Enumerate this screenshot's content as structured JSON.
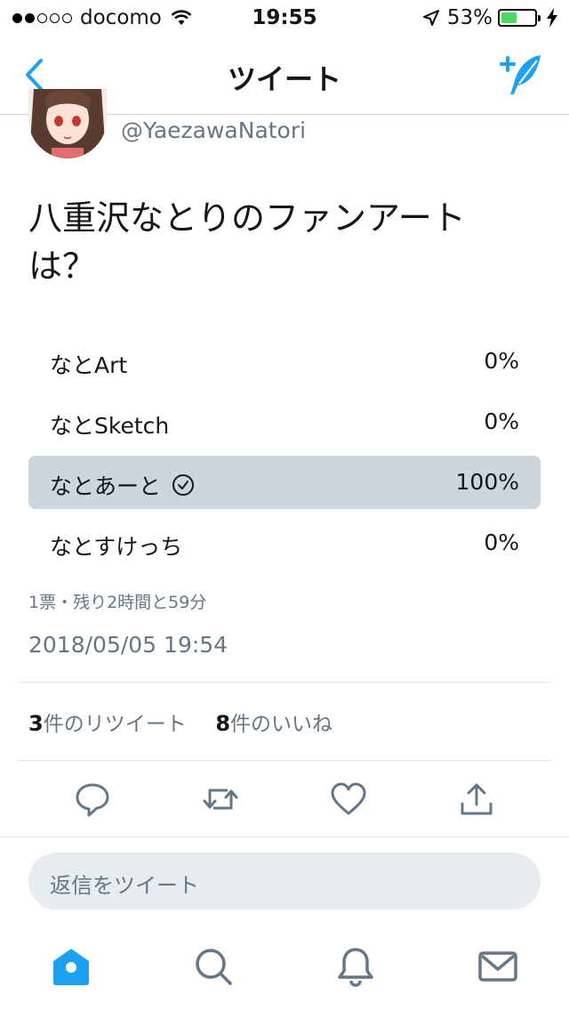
{
  "status_bar": {
    "carrier": "docomo",
    "time": "19:55",
    "battery_percent": "53%",
    "battery_level": 0.53,
    "signal_bars_filled": 2,
    "signal_bars_total": 5
  },
  "nav": {
    "title": "ツイート",
    "back_icon": "chevron-left-icon",
    "compose_icon": "compose-feather-icon"
  },
  "tweet": {
    "handle": "@YaezawaNatori",
    "text_line1": "八重沢なとりのファンアート",
    "text_line2": "は？"
  },
  "poll": {
    "options": [
      {
        "label": "なとArt",
        "percent": "0%"
      },
      {
        "label": "なとSketch",
        "percent": "0%"
      },
      {
        "label": "なとあーと",
        "percent": "100%",
        "selected": true
      },
      {
        "label": "なとすけっち",
        "percent": "0%"
      }
    ],
    "meta": "1票・残り2時間と59分"
  },
  "timestamp": "2018/05/05 19:54",
  "stats": {
    "retweet_count": "3",
    "retweet_label": "件のリツイート",
    "like_count": "8",
    "like_label": "件のいいね"
  },
  "actions": [
    "reply-icon",
    "retweet-icon",
    "like-icon",
    "share-icon"
  ],
  "reply_box": {
    "placeholder": "返信をツイート"
  },
  "tab_bar": [
    "home-icon",
    "search-icon",
    "notifications-icon",
    "messages-icon"
  ],
  "colors": {
    "accent": "#1da1f2",
    "icon_gray": "#657786",
    "selected_option": "#ccd6dd",
    "reply_box_bg": "#e6ecf0",
    "battery_green": "#4cd964"
  }
}
